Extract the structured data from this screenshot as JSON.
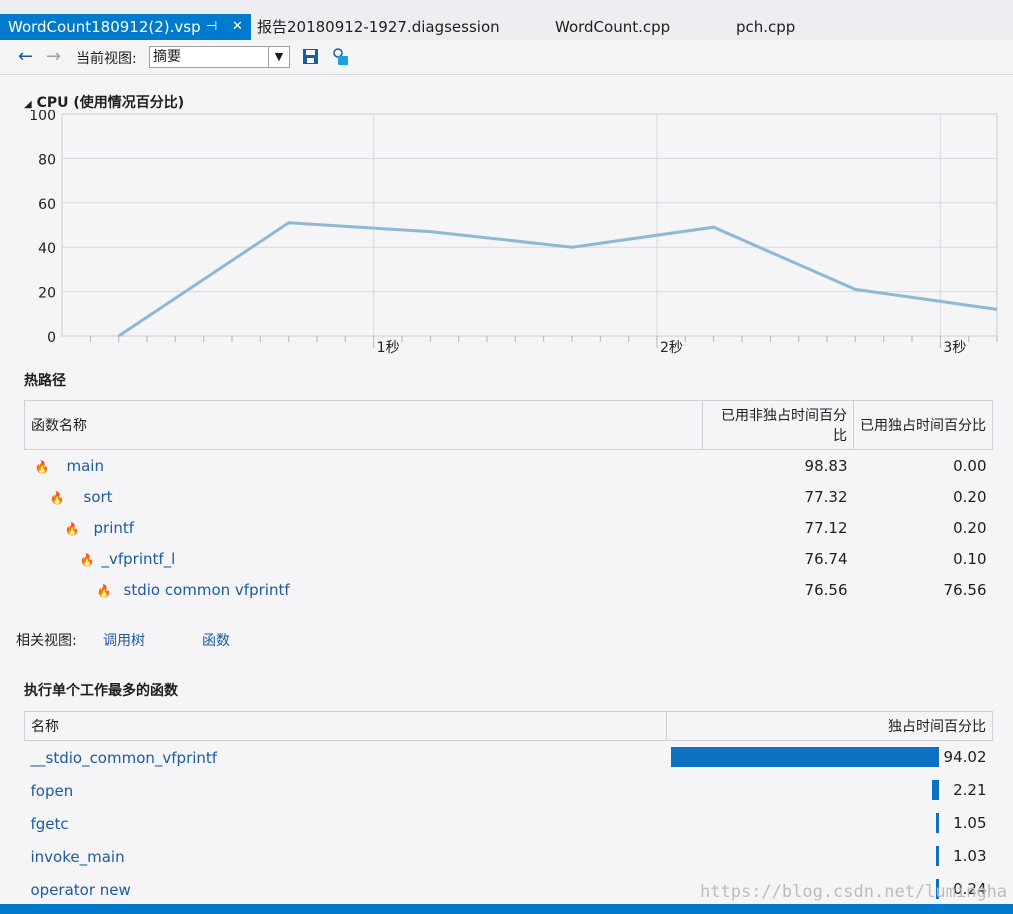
{
  "tabs": [
    {
      "label": "WordCount180912(2).vsp",
      "active": true
    },
    {
      "label": "报告20180912-1927.diagsession"
    },
    {
      "label": "WordCount.cpp"
    },
    {
      "label": "pch.cpp"
    }
  ],
  "toolbar": {
    "view_label": "当前视图:",
    "view_value": "摘要"
  },
  "cpu": {
    "title": "CPU (使用情况百分比)"
  },
  "chart_data": {
    "type": "line",
    "title": "CPU (使用情况百分比)",
    "y_ticks": [
      "100",
      "80",
      "60",
      "40",
      "20",
      "0"
    ],
    "x_tick_labels": [
      "1秒",
      "2秒",
      "3秒"
    ],
    "x": [
      0.1,
      0.7,
      1.2,
      1.7,
      2.2,
      2.7,
      3.2
    ],
    "values": [
      0,
      51,
      47,
      40,
      49,
      21,
      12
    ],
    "ylim": [
      0,
      100
    ],
    "xlim": [
      -0.1,
      3.2
    ],
    "grid": true,
    "color": "#8fb8d4"
  },
  "hot_path": {
    "title": "热路径",
    "headers": [
      "函数名称",
      "已用非独占时间百分比",
      "已用独占时间百分比"
    ],
    "rows": [
      {
        "name": "main",
        "inclusive": "98.83",
        "exclusive": "0.00"
      },
      {
        "name": "sort",
        "inclusive": "77.32",
        "exclusive": "0.20"
      },
      {
        "name": "printf",
        "inclusive": "77.12",
        "exclusive": "0.20"
      },
      {
        "name": "_vfprintf_l",
        "inclusive": "76.74",
        "exclusive": "0.10"
      },
      {
        "name": "stdio  common  vfprintf",
        "inclusive": "76.56",
        "exclusive": "76.56"
      }
    ]
  },
  "related": {
    "label": "相关视图:",
    "call_tree": "调用树",
    "functions": "函数"
  },
  "most_work": {
    "title": "执行单个工作最多的函数",
    "headers": [
      "名称",
      "独占时间百分比"
    ],
    "rows": [
      {
        "name": "__stdio_common_vfprintf",
        "value": "94.02",
        "pct": 94.02
      },
      {
        "name": "fopen",
        "value": "2.21",
        "pct": 2.21
      },
      {
        "name": "fgetc",
        "value": "1.05",
        "pct": 1.05
      },
      {
        "name": "invoke_main",
        "value": "1.03",
        "pct": 1.03
      },
      {
        "name": "operator new",
        "value": "0.24",
        "pct": 0.24
      }
    ]
  },
  "watermark": "https://blog.csdn.net/lumingha",
  "colors": {
    "accent": "#007acc",
    "bar": "#0e70c0",
    "line": "#8fb8d4"
  }
}
